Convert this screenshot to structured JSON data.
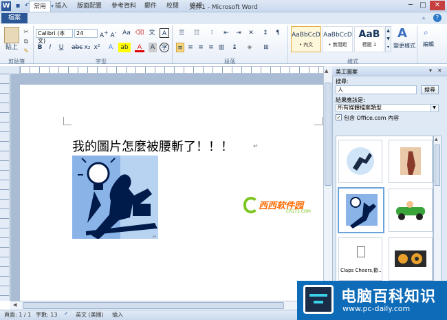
{
  "window": {
    "title": "文件1 - Microsoft Word"
  },
  "tabs": [
    "檔案",
    "常用",
    "插入",
    "版面配置",
    "參考資料",
    "郵件",
    "校閱",
    "檢視"
  ],
  "ribbon": {
    "clipboard": {
      "paste": "貼上",
      "group": "剪貼簿"
    },
    "font": {
      "name": "Calibri (本文)",
      "size": "24",
      "group": "字型"
    },
    "paragraph": {
      "group": "段落"
    },
    "styles": {
      "group": "樣式",
      "items": [
        {
          "sample": "AaBbCcD",
          "name": "• 內文"
        },
        {
          "sample": "AaBbCcD",
          "name": "• 無間距"
        },
        {
          "sample": "AaB",
          "name": "標題 1"
        }
      ],
      "change_styles": "變更樣式"
    },
    "editing": {
      "label": "編輯"
    }
  },
  "document": {
    "text": "我的圖片怎麼被腰斬了！！！"
  },
  "clipart_pane": {
    "title": "美工圖案",
    "search_label": "搜尋:",
    "search_value": "人",
    "search_button": "搜尋",
    "results_label": "結果應該是:",
    "results_type": "所有媒體檔案類型",
    "include_office": "包含 Office.com 內容",
    "include_checked": true,
    "item_caption": "Claps Cheers,歡..."
  },
  "status": {
    "page": "頁面: 1 / 1",
    "words": "字數: 13",
    "language": "英文 (美國)",
    "mode": "插入"
  },
  "overlay": {
    "xixi_text": "西西软件园",
    "xixi_url": "CR173.COM",
    "watermark_cn": "电脑百科知识",
    "watermark_url": "www.pc-daily.com"
  }
}
